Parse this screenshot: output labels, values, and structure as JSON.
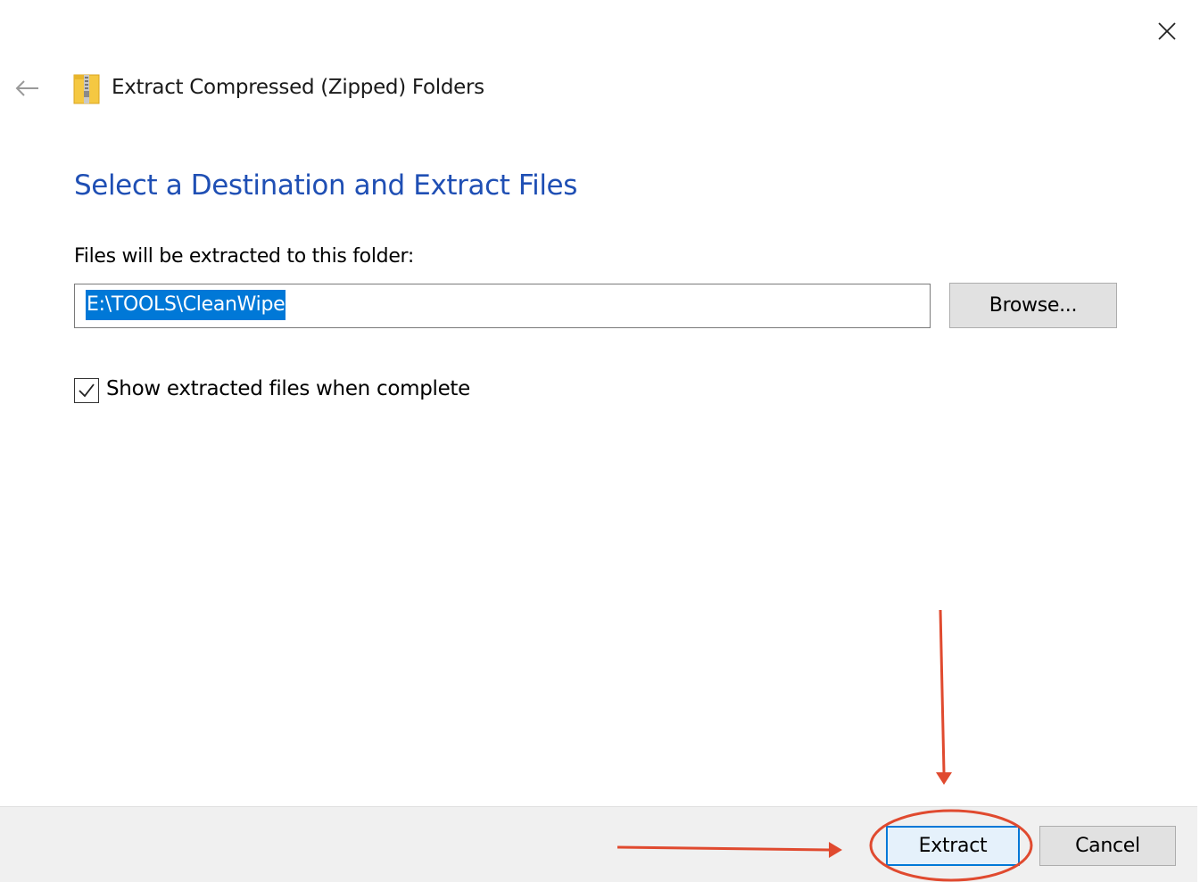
{
  "window": {
    "title": "Extract Compressed (Zipped) Folders",
    "close_icon": "close-icon",
    "back_icon": "arrow-left-icon",
    "app_icon": "zip-folder-icon"
  },
  "main": {
    "heading": "Select a Destination and Extract Files",
    "destination_label": "Files will be extracted to this folder:",
    "destination_value": "E:\\TOOLS\\CleanWipe",
    "browse_label": "Browse...",
    "show_files_label": "Show extracted files when complete",
    "show_files_checked": true
  },
  "footer": {
    "extract_label": "Extract",
    "cancel_label": "Cancel"
  },
  "colors": {
    "heading": "#1f4fb4",
    "selection": "#0078d7",
    "annotation": "#e04a2f",
    "footer_bg": "#f0f0f0"
  }
}
